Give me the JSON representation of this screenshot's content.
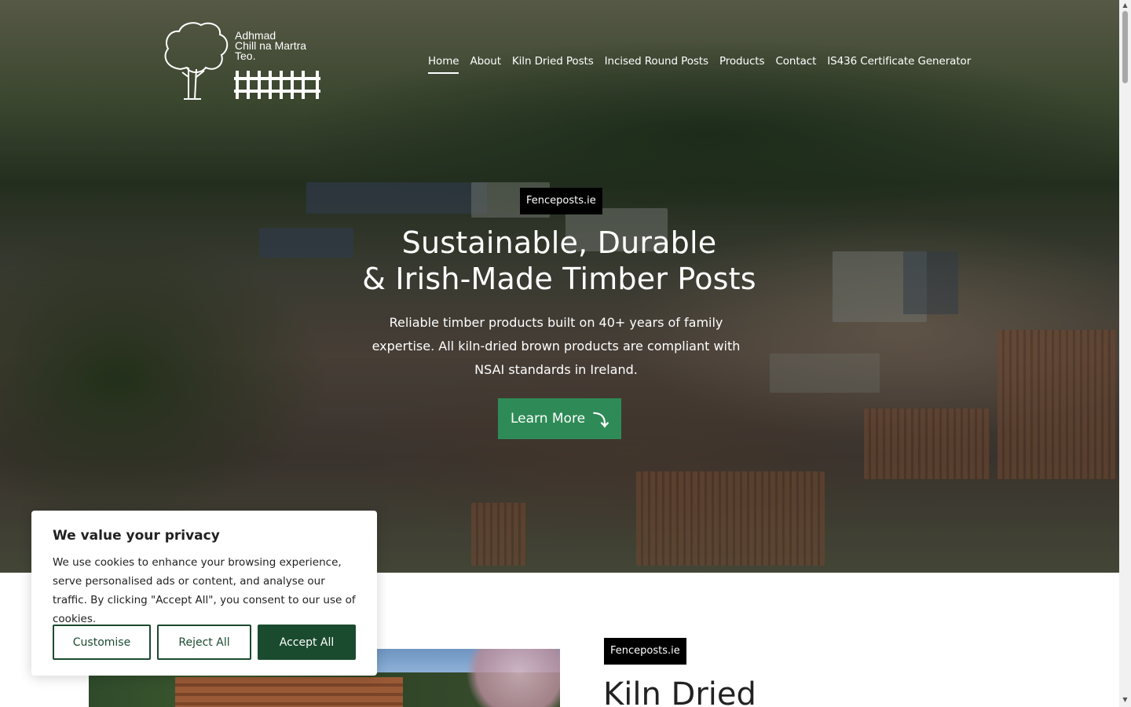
{
  "header": {
    "logo_lines": [
      "Adhmad",
      "Chill na Martra",
      "Teo."
    ],
    "nav": [
      {
        "label": "Home",
        "active": true
      },
      {
        "label": "About"
      },
      {
        "label": "Kiln Dried Posts"
      },
      {
        "label": "Incised Round Posts"
      },
      {
        "label": "Products"
      },
      {
        "label": "Contact"
      },
      {
        "label": "IS436 Certificate Generator"
      }
    ]
  },
  "hero": {
    "tag": "Fenceposts.ie",
    "title_line1": "Sustainable, Durable",
    "title_line2": "& Irish-Made Timber Posts",
    "subtitle": "Reliable timber products built on 40+ years of family expertise. All kiln-dried brown products are compliant with NSAI standards in Ireland.",
    "cta_label": "Learn More",
    "cta_icon": "arrow-down-icon",
    "cta_color": "#2e8b57"
  },
  "section": {
    "tag": "Fenceposts.ie",
    "title": "Kiln Dried"
  },
  "cookie_banner": {
    "title": "We value your privacy",
    "text": "We use cookies to enhance your browsing experience, serve personalised ads or content, and analyse our traffic. By clicking \"Accept All\", you consent to our use of cookies.",
    "customise_label": "Customise",
    "reject_label": "Reject All",
    "accept_label": "Accept All",
    "accent_color": "#1b4b2f"
  }
}
